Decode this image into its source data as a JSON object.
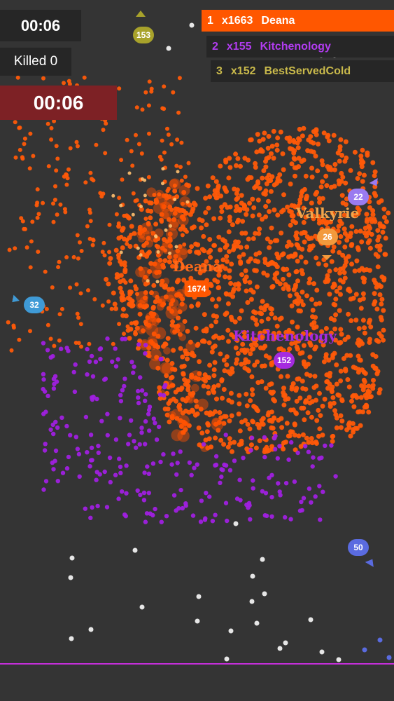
{
  "hud": {
    "timer_small": "00:06",
    "killed_label": "Killed 0",
    "timer_big": "00:06"
  },
  "leaderboard": [
    {
      "rank": "1",
      "count": "x1663",
      "name": "Deana",
      "color": "#ff5700"
    },
    {
      "rank": "2",
      "count": "x155",
      "name": "Kitchenology",
      "color": "#b23cf0"
    },
    {
      "rank": "3",
      "count": "x152",
      "name": "BestServedCold",
      "color": "#c9b94b"
    }
  ],
  "players": {
    "deana": {
      "name": "Deana",
      "badge": "1674",
      "color": "#ff5700"
    },
    "valkyrie": {
      "name": "Valkyrie",
      "badge": "26",
      "color": "#f39a3c"
    },
    "kitchenology": {
      "name": "Kitchenology",
      "badge": "152",
      "color": "#a52bdf"
    },
    "olive": {
      "badge": "153",
      "color": "#a8a22b"
    },
    "blue_left": {
      "badge": "32",
      "color": "#3f9ad6"
    },
    "lavender": {
      "badge": "22",
      "color": "#9a7bf0"
    },
    "periwinkle": {
      "badge": "50",
      "color": "#5a6be0"
    }
  },
  "colors": {
    "background": "#343434",
    "orange_crowd": "#ff5a08",
    "purple_crowd": "#a020e0",
    "neutral": "#e6e6e6",
    "arena_border": "#c42fd9"
  }
}
